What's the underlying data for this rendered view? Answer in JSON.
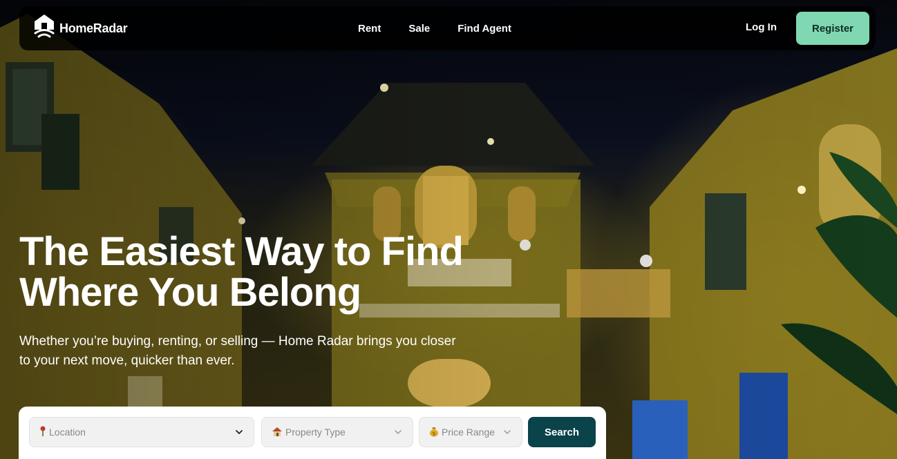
{
  "brand": {
    "name": "HomeRadar",
    "logo_icon": "house-radar-icon"
  },
  "nav": {
    "links": [
      "Rent",
      "Sale",
      "Find Agent"
    ],
    "login_label": "Log In",
    "register_label": "Register"
  },
  "hero": {
    "headline_line1": "The Easiest Way to Find",
    "headline_line2": "Where You Belong",
    "subtitle_line1": "Whether you’re buying, renting, or selling — Home Radar brings you closer",
    "subtitle_line2": "to your next move, quicker than ever."
  },
  "search": {
    "location_placeholder": "Location",
    "location_icon": "pin-icon",
    "property_type_placeholder": "Property Type",
    "property_type_icon": "house-icon",
    "price_range_placeholder": "Price Range",
    "price_range_icon": "money-bag-icon",
    "button_label": "Search"
  },
  "colors": {
    "accent": "#7fd8b2",
    "search_button": "#0b434a",
    "nav_background": "#000000"
  }
}
